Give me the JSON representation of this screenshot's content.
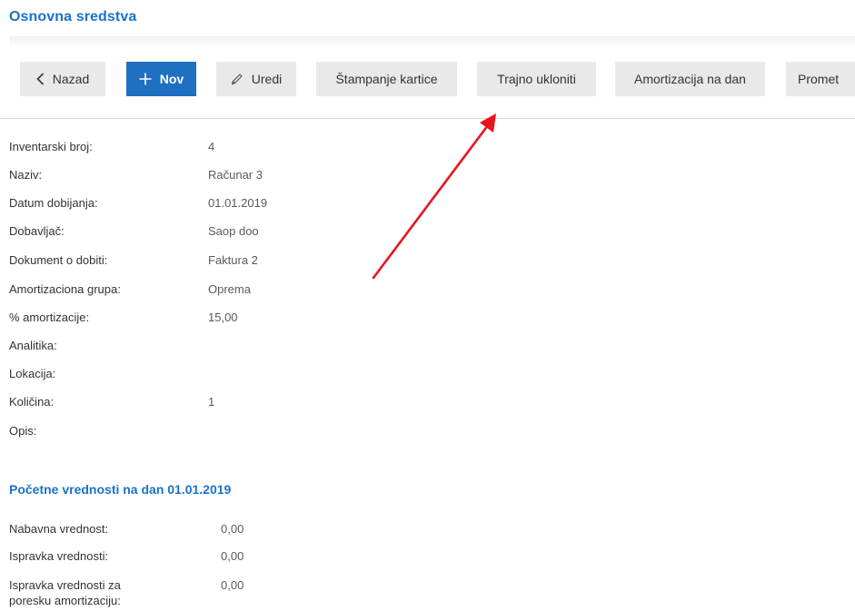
{
  "page": {
    "title": "Osnovna sredstva"
  },
  "toolbar": {
    "back_label": "Nazad",
    "new_label": "Nov",
    "edit_label": "Uredi",
    "print_label": "Štampanje kartice",
    "delete_label": "Trajno ukloniti",
    "depreciation_label": "Amortizacija na dan",
    "turnover_label": "Promet"
  },
  "details": [
    {
      "label": "Inventarski broj:",
      "value": "4"
    },
    {
      "label": "Naziv:",
      "value": "Računar 3"
    },
    {
      "label": "Datum dobijanja:",
      "value": "01.01.2019"
    },
    {
      "label": "Dobavljač:",
      "value": "Saop doo"
    },
    {
      "label": "Dokument o dobiti:",
      "value": "Faktura 2"
    },
    {
      "label": "Amortizaciona grupa:",
      "value": "Oprema"
    },
    {
      "label": "% amortizacije:",
      "value": "15,00"
    },
    {
      "label": "Analitika:",
      "value": ""
    },
    {
      "label": "Lokacija:",
      "value": ""
    },
    {
      "label": "Količina:",
      "value": "1"
    },
    {
      "label": "Opis:",
      "value": ""
    }
  ],
  "initial_values": {
    "title": "Početne vrednosti na dan 01.01.2019",
    "rows": [
      {
        "label": "Nabavna vrednost:",
        "value": "0,00"
      },
      {
        "label": "Ispravka vrednosti:",
        "value": "0,00"
      },
      {
        "label": "Ispravka vrednosti za",
        "label2": "poresku amortizaciju:",
        "value": "0,00"
      }
    ]
  },
  "icons": {
    "back": "chevron-left-icon",
    "new": "plus-icon",
    "edit": "pencil-icon"
  },
  "colors": {
    "accent": "#1a73c8",
    "primary_button": "#1f70c1",
    "button_bg": "#e9e9e9",
    "annotation_arrow": "#e8141b"
  }
}
